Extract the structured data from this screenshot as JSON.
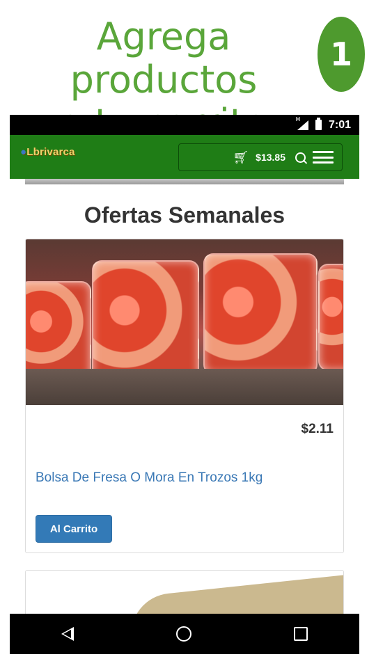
{
  "headline": {
    "line1": "Agrega productos",
    "line2": "a tu carrito",
    "step": "1"
  },
  "status_bar": {
    "time": "7:01",
    "network": "H"
  },
  "app_bar": {
    "logo_text": "Lbrivarca",
    "cart_total": "$13.85"
  },
  "section": {
    "title": "Ofertas Semanales"
  },
  "product": {
    "price": "$2.11",
    "name": "Bolsa De Fresa O Mora En Trozos 1kg",
    "button_label": "Al Carrito"
  },
  "icons": [
    "shopping-cart-icon",
    "search-icon",
    "hamburger-menu-icon",
    "back-icon",
    "home-icon",
    "recent-apps-icon"
  ],
  "colors": {
    "brand_green": "#1f7d16",
    "accent_blue": "#337ab7",
    "headline_green": "#5aa63a"
  }
}
